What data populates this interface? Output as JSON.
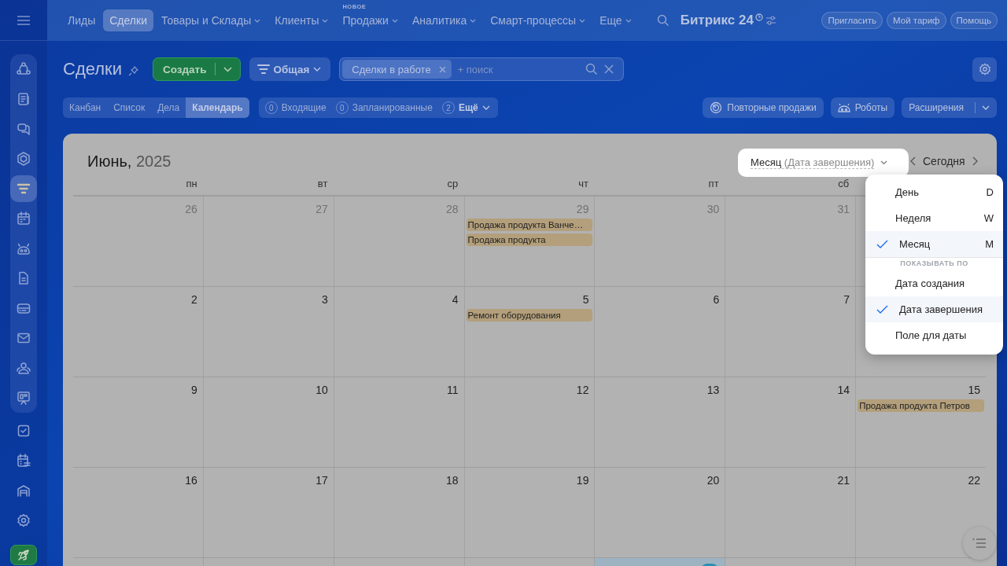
{
  "top_nav": {
    "items": [
      {
        "label": "Лиды",
        "selected": false,
        "dropdown": false
      },
      {
        "label": "Сделки",
        "selected": true,
        "dropdown": false
      },
      {
        "label": "Товары и Склады",
        "selected": false,
        "dropdown": true
      },
      {
        "label": "Клиенты",
        "selected": false,
        "dropdown": true
      },
      {
        "label": "Продажи",
        "selected": false,
        "dropdown": true,
        "badge": "НОВОЕ"
      },
      {
        "label": "Аналитика",
        "selected": false,
        "dropdown": true
      },
      {
        "label": "Смарт-процессы",
        "selected": false,
        "dropdown": true
      },
      {
        "label": "Еще",
        "selected": false,
        "dropdown": true
      }
    ],
    "brand": "Битрикс",
    "brand_number": "24",
    "buttons": [
      "Пригласить",
      "Мой тариф",
      "Помощь"
    ]
  },
  "sidebar": {
    "items": [
      {
        "kind": "flow",
        "selected": false,
        "group": true
      },
      {
        "kind": "news",
        "selected": false,
        "group": true
      },
      {
        "kind": "chat",
        "selected": false,
        "group": true
      },
      {
        "kind": "hexagon",
        "selected": false,
        "group": true
      },
      {
        "kind": "funnel",
        "selected": true,
        "group": true
      },
      {
        "kind": "calendar",
        "selected": false,
        "group": true
      },
      {
        "kind": "robot",
        "selected": false,
        "group": true
      },
      {
        "kind": "doc",
        "selected": false,
        "group": true
      },
      {
        "kind": "card",
        "selected": false,
        "group": true
      },
      {
        "kind": "mail",
        "selected": false,
        "group": true
      },
      {
        "kind": "people",
        "selected": false,
        "group": true
      },
      {
        "kind": "board",
        "selected": false,
        "group": true
      },
      {
        "kind": "check",
        "selected": false,
        "group": false
      },
      {
        "kind": "planner",
        "selected": false,
        "group": false
      },
      {
        "kind": "garage",
        "selected": false,
        "group": false
      },
      {
        "kind": "gear",
        "selected": false,
        "group": false
      },
      {
        "kind": "rocket",
        "selected": false,
        "group": false
      }
    ]
  },
  "page": {
    "title": "Сделки",
    "create_button": "Создать",
    "filter_preset": "Общая",
    "search": {
      "chip": "Сделки в работе",
      "placeholder": "+ поиск"
    }
  },
  "view_tabs": [
    {
      "label": "Канбан",
      "selected": false
    },
    {
      "label": "Список",
      "selected": false
    },
    {
      "label": "Дела",
      "selected": false
    },
    {
      "label": "Календарь",
      "selected": true
    }
  ],
  "counters": [
    {
      "count": "0",
      "label": "Входящие",
      "dropdown": false
    },
    {
      "count": "0",
      "label": "Запланированные",
      "dropdown": false
    },
    {
      "count": "2",
      "label": "Ещё",
      "dropdown": true
    }
  ],
  "actions": [
    {
      "label": "Повторные продажи",
      "kind": "repeat"
    },
    {
      "label": "Роботы",
      "kind": "robot"
    },
    {
      "label": "Расширения",
      "kind": "split"
    }
  ],
  "calendar": {
    "month": "Июнь,",
    "year": "2025",
    "view_mode": "Месяц",
    "view_basis": "(Дата завершения)",
    "today_button": "Сегодня",
    "weekdays": [
      "пн",
      "вт",
      "ср",
      "чт",
      "пт",
      "сб"
    ],
    "weeks": [
      [
        {
          "day": "26",
          "muted": true
        },
        {
          "day": "27",
          "muted": true
        },
        {
          "day": "28",
          "muted": true
        },
        {
          "day": "29",
          "muted": true,
          "events": [
            "Продажа продукта Ванче…",
            "Продажа продукта"
          ]
        },
        {
          "day": "30",
          "muted": true
        },
        {
          "day": "31",
          "muted": true
        }
      ],
      [
        {
          "day": "2",
          "muted": false
        },
        {
          "day": "3",
          "muted": false
        },
        {
          "day": "4",
          "muted": false
        },
        {
          "day": "5",
          "muted": false,
          "events": [
            "Ремонт оборудования"
          ]
        },
        {
          "day": "6",
          "muted": false
        },
        {
          "day": "7",
          "muted": false
        }
      ],
      [
        {
          "day": "9",
          "muted": false
        },
        {
          "day": "10",
          "muted": false
        },
        {
          "day": "11",
          "muted": false
        },
        {
          "day": "12",
          "muted": false
        },
        {
          "day": "13",
          "muted": false
        },
        {
          "day": "14",
          "muted": false
        },
        {
          "day": "15",
          "muted": false,
          "events": [
            "Продажа продукта Петров"
          ]
        }
      ],
      [
        {
          "day": "16",
          "muted": false
        },
        {
          "day": "17",
          "muted": false
        },
        {
          "day": "18",
          "muted": false
        },
        {
          "day": "19",
          "muted": false
        },
        {
          "day": "20",
          "muted": false
        },
        {
          "day": "21",
          "muted": false
        },
        {
          "day": "22",
          "muted": false
        }
      ]
    ],
    "partial_week": [
      {
        "today": false
      },
      {
        "today": false
      },
      {
        "today": false
      },
      {
        "today": false
      },
      {
        "today": true
      },
      {
        "today": false
      },
      {
        "today": false
      }
    ]
  },
  "view_menu": {
    "items": [
      {
        "label": "День",
        "shortcut": "D",
        "selected": false
      },
      {
        "label": "Неделя",
        "shortcut": "W",
        "selected": false
      },
      {
        "label": "Месяц",
        "shortcut": "M",
        "selected": true
      }
    ],
    "section_label": "ПОКАЗЫВАТЬ ПО",
    "basis_items": [
      {
        "label": "Дата создания",
        "selected": false
      },
      {
        "label": "Дата завершения",
        "selected": true
      },
      {
        "label": "Поле для даты",
        "selected": false
      }
    ]
  }
}
